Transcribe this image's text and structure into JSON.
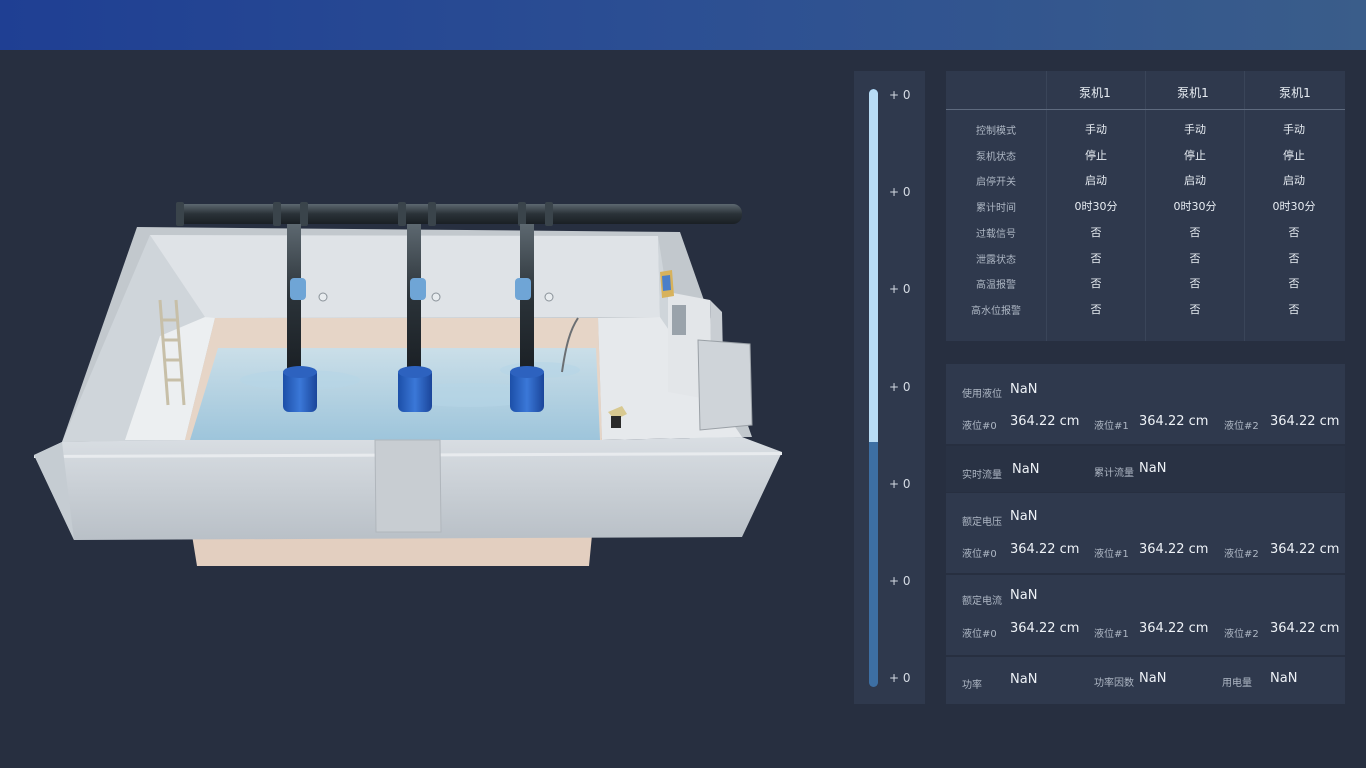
{
  "gauge": {
    "level_fraction": 0.41,
    "ticks": [
      "+ 0",
      "+ 0",
      "+ 0",
      "+ 0",
      "+ 0",
      "+ 0",
      "+ 0"
    ]
  },
  "pump_table": {
    "headers": [
      "泵机1",
      "泵机1",
      "泵机1"
    ],
    "rows": [
      {
        "label": "控制模式",
        "values": [
          "手动",
          "手动",
          "手动"
        ]
      },
      {
        "label": "泵机状态",
        "values": [
          "停止",
          "停止",
          "停止"
        ]
      },
      {
        "label": "启停开关",
        "values": [
          "启动",
          "启动",
          "启动"
        ]
      },
      {
        "label": "累计时间",
        "values": [
          "0时30分",
          "0时30分",
          "0时30分"
        ]
      },
      {
        "label": "过载信号",
        "values": [
          "否",
          "否",
          "否"
        ]
      },
      {
        "label": "泄露状态",
        "values": [
          "否",
          "否",
          "否"
        ]
      },
      {
        "label": "高温报警",
        "values": [
          "否",
          "否",
          "否"
        ]
      },
      {
        "label": "高水位报警",
        "values": [
          "否",
          "否",
          "否"
        ]
      }
    ]
  },
  "level_panel": {
    "use_label": "使用液位",
    "use_value": "NaN",
    "items": [
      {
        "label": "液位#0",
        "value": "364.22 cm"
      },
      {
        "label": "液位#1",
        "value": "364.22 cm"
      },
      {
        "label": "液位#2",
        "value": "364.22 cm"
      }
    ]
  },
  "flow_panel": {
    "realtime_label": "实时流量",
    "realtime_value": "NaN",
    "total_label": "累计流量",
    "total_value": "NaN"
  },
  "voltage_panel": {
    "label": "额定电压",
    "value": "NaN",
    "items": [
      {
        "label": "液位#0",
        "value": "364.22 cm"
      },
      {
        "label": "液位#1",
        "value": "364.22 cm"
      },
      {
        "label": "液位#2",
        "value": "364.22 cm"
      }
    ]
  },
  "current_panel": {
    "label": "额定电流",
    "value": "NaN",
    "items": [
      {
        "label": "液位#0",
        "value": "364.22 cm"
      },
      {
        "label": "液位#1",
        "value": "364.22 cm"
      },
      {
        "label": "液位#2",
        "value": "364.22 cm"
      }
    ]
  },
  "power_panel": {
    "power_label": "功率",
    "power_value": "NaN",
    "factor_label": "功率因数",
    "factor_value": "NaN",
    "energy_label": "用电量",
    "energy_value": "NaN"
  },
  "colors": {
    "background": "#272f40",
    "panel": "#2f394d",
    "header_start": "#1f3f93",
    "header_end": "#3a5d8a",
    "gauge_fill": "#3d6fa3",
    "gauge_light": "#b8dcf5"
  }
}
